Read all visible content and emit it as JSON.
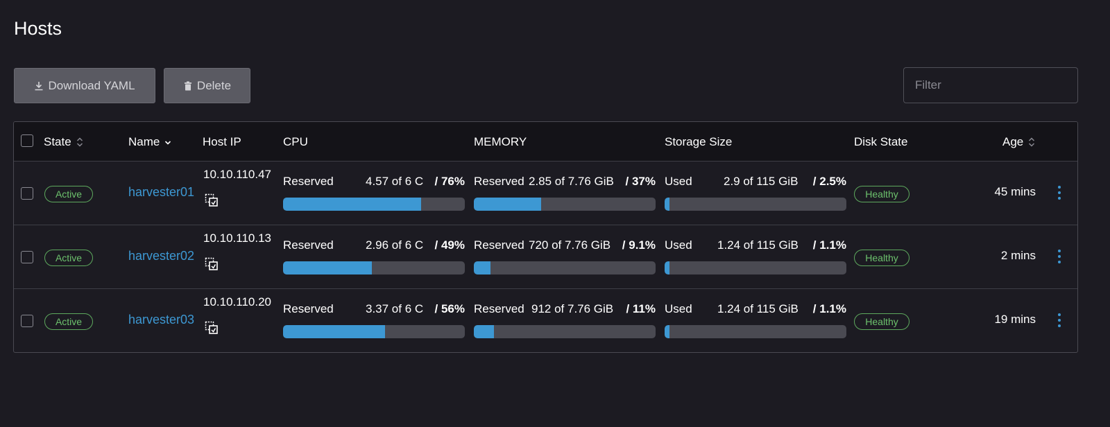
{
  "page": {
    "title": "Hosts"
  },
  "toolbar": {
    "download_label": "Download YAML",
    "delete_label": "Delete",
    "filter_placeholder": "Filter"
  },
  "table": {
    "columns": {
      "state": "State",
      "name": "Name",
      "host_ip": "Host IP",
      "cpu": "CPU",
      "memory": "MEMORY",
      "storage": "Storage Size",
      "disk_state": "Disk State",
      "age": "Age"
    },
    "rows": [
      {
        "state": "Active",
        "name": "harvester01",
        "host_ip": "10.10.110.47",
        "cpu": {
          "label": "Reserved",
          "amount": "4.57 of 6 C",
          "pct": "/ 76%",
          "value": 76
        },
        "memory": {
          "label": "Reserved",
          "amount": "2.85 of 7.76 GiB",
          "pct": "/ 37%",
          "value": 37
        },
        "storage": {
          "label": "Used",
          "amount": "2.9 of 115 GiB",
          "pct": "/ 2.5%",
          "value": 2.5
        },
        "disk_state": "Healthy",
        "age": "45 mins"
      },
      {
        "state": "Active",
        "name": "harvester02",
        "host_ip": "10.10.110.13",
        "cpu": {
          "label": "Reserved",
          "amount": "2.96 of 6 C",
          "pct": "/ 49%",
          "value": 49
        },
        "memory": {
          "label": "Reserved",
          "amount": "720 of 7.76 GiB",
          "pct": "/ 9.1%",
          "value": 9.1
        },
        "storage": {
          "label": "Used",
          "amount": "1.24 of 115 GiB",
          "pct": "/ 1.1%",
          "value": 1.1
        },
        "disk_state": "Healthy",
        "age": "2 mins"
      },
      {
        "state": "Active",
        "name": "harvester03",
        "host_ip": "10.10.110.20",
        "cpu": {
          "label": "Reserved",
          "amount": "3.37 of 6 C",
          "pct": "/ 56%",
          "value": 56
        },
        "memory": {
          "label": "Reserved",
          "amount": "912 of 7.76 GiB",
          "pct": "/ 11%",
          "value": 11
        },
        "storage": {
          "label": "Used",
          "amount": "1.24 of 115 GiB",
          "pct": "/ 1.1%",
          "value": 1.1
        },
        "disk_state": "Healthy",
        "age": "19 mins"
      }
    ]
  },
  "colors": {
    "background": "#1c1b22",
    "accent": "#3d98d3",
    "success": "#6dc26d",
    "bar_track": "#4a4a52"
  },
  "icons": {
    "download": "download-icon",
    "delete": "trash-icon",
    "sort": "sort-icon",
    "copy": "copy-icon",
    "actions": "kebab-menu-icon"
  }
}
